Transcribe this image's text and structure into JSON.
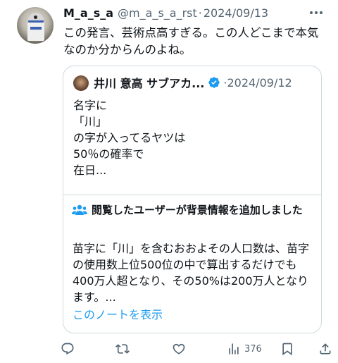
{
  "tweet": {
    "display_name": "M_a_s_a",
    "handle": "@m_a_s_a_rst",
    "separator": "·",
    "date": "2024/09/13",
    "text": "この発言、芸術点高すぎる。この人どこまで本気なのか分からんのよね。"
  },
  "quote": {
    "author": "井川 意高 サブアカ...",
    "separator": "·",
    "date": "2024/09/12",
    "text": "名字に\n「川」\nの字が入ってるヤツは\n50％の確率で\n在日..."
  },
  "community_note": {
    "title": "閲覧したユーザーが背景情報を追加しました",
    "body": "苗字に「川」を含むおおよその人口数は、苗字の使用数上位500位の中で算出するだけでも400万人超となり、その50%は200万人となります。...",
    "link": "このノートを表示"
  },
  "actions": {
    "views_count": "376"
  },
  "colors": {
    "accent": "#1d9bf0",
    "secondary_text": "#536471",
    "border": "#cfd9de"
  },
  "icons": [
    "more-icon",
    "verified-icon",
    "people-icon",
    "reply-icon",
    "repost-icon",
    "like-icon",
    "views-icon",
    "bookmark-icon",
    "share-icon"
  ]
}
